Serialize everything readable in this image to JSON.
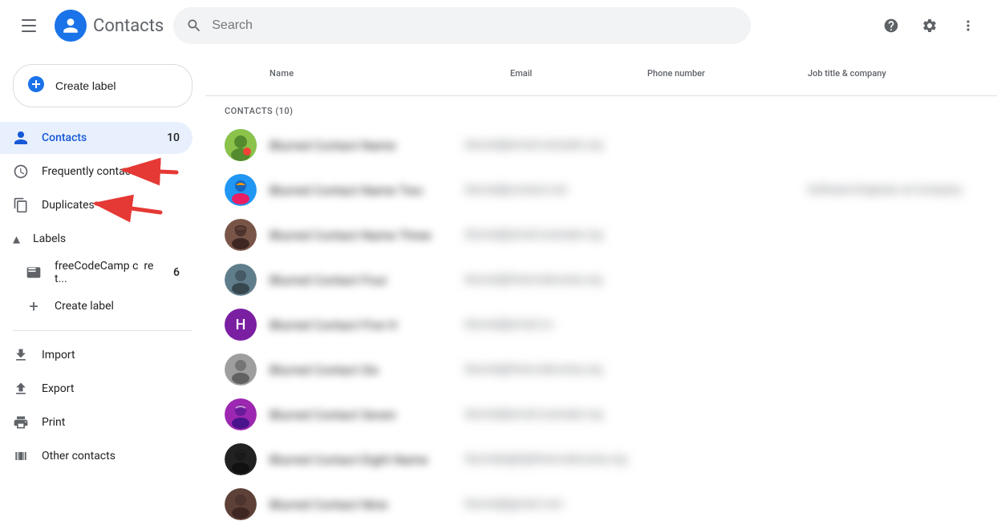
{
  "app": {
    "title": "Contacts",
    "logo_initial": "👤"
  },
  "topbar": {
    "search_placeholder": "Search",
    "help_tooltip": "Help",
    "settings_tooltip": "Settings",
    "more_tooltip": "More"
  },
  "sidebar": {
    "create_label": "Create label",
    "nav_items": [
      {
        "id": "contacts",
        "label": "Contacts",
        "badge": "10",
        "active": true,
        "icon": "person"
      },
      {
        "id": "frequently-contacted",
        "label": "Frequently contacted",
        "badge": "",
        "active": false,
        "icon": "clock"
      },
      {
        "id": "duplicates",
        "label": "Duplicates",
        "badge": "",
        "active": false,
        "icon": "copy"
      }
    ],
    "labels_header": "Labels",
    "labels_collapsed": false,
    "label_items": [
      {
        "id": "freeCodeCamp",
        "label": "freeCodeCamp c  re t...",
        "badge": "6"
      }
    ],
    "bottom_items": [
      {
        "id": "import",
        "label": "Import",
        "icon": "upload"
      },
      {
        "id": "export",
        "label": "Export",
        "icon": "download"
      },
      {
        "id": "print",
        "label": "Print",
        "icon": "print"
      },
      {
        "id": "other-contacts",
        "label": "Other contacts",
        "icon": "contacts-book"
      }
    ]
  },
  "contacts_list": {
    "header_name": "Name",
    "header_email": "Email",
    "header_phone": "Phone number",
    "header_job": "Job title & company",
    "count_label": "CONTACTS (10)",
    "contacts": [
      {
        "id": 1,
        "name": "blurred name 1",
        "email": "blurred@email.com",
        "phone": "",
        "job": "",
        "avatar_type": "image",
        "avatar_color": "#4caf50",
        "avatar_letter": ""
      },
      {
        "id": 2,
        "name": "blurred name 2",
        "email": "blurred@email.com",
        "phone": "",
        "job": "blurred job title",
        "avatar_type": "image",
        "avatar_color": "#e91e63",
        "avatar_letter": ""
      },
      {
        "id": 3,
        "name": "blurred name 3",
        "email": "blurred@email.com",
        "phone": "",
        "job": "",
        "avatar_type": "image",
        "avatar_color": "#795548",
        "avatar_letter": ""
      },
      {
        "id": 4,
        "name": "blurred name 4",
        "email": "blurred@email.com",
        "phone": "",
        "job": "",
        "avatar_type": "image",
        "avatar_color": "#607d8b",
        "avatar_letter": ""
      },
      {
        "id": 5,
        "name": "blurred name 5",
        "email": "blurred@email.com",
        "phone": "",
        "job": "",
        "avatar_type": "letter",
        "avatar_color": "#7b1fa2",
        "avatar_letter": "H"
      },
      {
        "id": 6,
        "name": "blurred name 6",
        "email": "blurred@email.com",
        "phone": "",
        "job": "",
        "avatar_type": "image",
        "avatar_color": "#9e9e9e",
        "avatar_letter": ""
      },
      {
        "id": 7,
        "name": "blurred name 7",
        "email": "blurred@email.com",
        "phone": "",
        "job": "",
        "avatar_type": "image",
        "avatar_color": "#9c27b0",
        "avatar_letter": ""
      },
      {
        "id": 8,
        "name": "blurred name 8",
        "email": "blurred@email.com",
        "phone": "",
        "job": "",
        "avatar_type": "image",
        "avatar_color": "#212121",
        "avatar_letter": ""
      },
      {
        "id": 9,
        "name": "blurred name 9",
        "email": "blurred@email.com",
        "phone": "",
        "job": "",
        "avatar_type": "image",
        "avatar_color": "#5d4037",
        "avatar_letter": ""
      }
    ]
  },
  "arrows": {
    "arrow1_label": "Arrow pointing to Frequently contacted",
    "arrow2_label": "Arrow pointing to Duplicates"
  }
}
